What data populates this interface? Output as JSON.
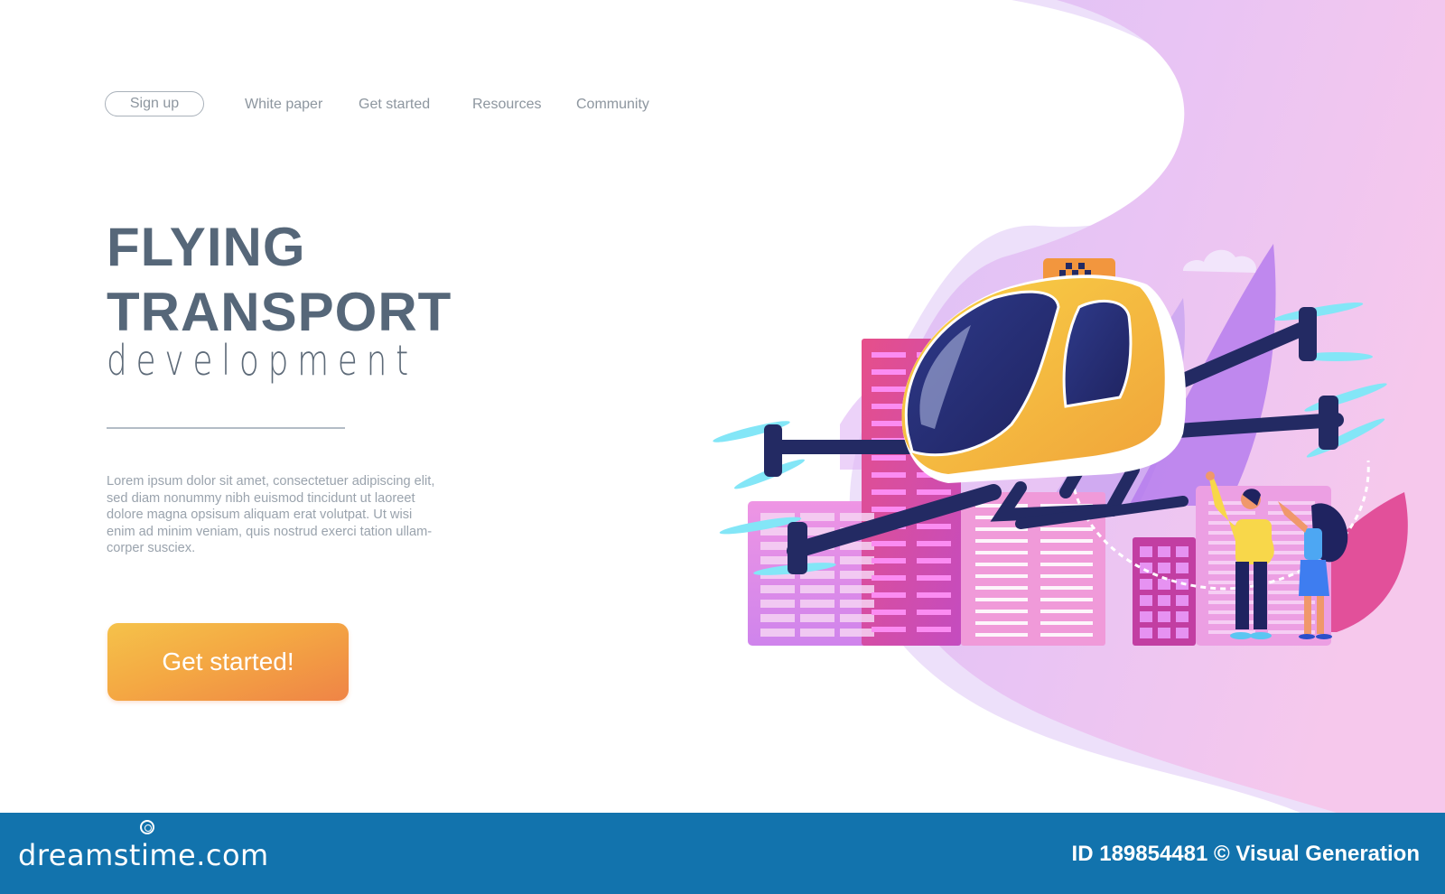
{
  "nav": {
    "signup_label": "Sign up",
    "links": [
      "White paper",
      "Get started",
      "Resources",
      "Community"
    ]
  },
  "hero": {
    "title_line1": "FLYING",
    "title_line2": "TRANSPORT",
    "subtitle": "development",
    "body_lines": [
      "Lorem ipsum dolor sit amet, consectetuer adipiscing elit,",
      "sed diam nonummy nibh euismod tincidunt ut laoreet",
      "dolore magna opsisum aliquam erat volutpat. Ut wisi",
      "enim ad minim veniam, quis nostrud exerci tation ullam-",
      "corper susciex."
    ],
    "cta_label": "Get started!"
  },
  "illustration": {
    "subject": "flying-taxi-drone-over-city",
    "colors": {
      "blob_light": "#e7c9f7",
      "blob_pink": "#f5c6ee",
      "taxi_yellow": "#f7c43a",
      "taxi_orange": "#f2963e",
      "navy": "#232a63",
      "propeller": "#7fe3f5",
      "building_pink": "#e977d9",
      "building_magenta": "#d6408e",
      "building_violet": "#b46be6"
    }
  },
  "footer": {
    "logo_text": "dreamstime.com",
    "credit": "ID 189854481 © Visual Generation"
  },
  "colors": {
    "heading": "#566779",
    "nav_text": "#8d969f",
    "body_text": "#9aa3ad",
    "cta_start": "#f5c24a",
    "cta_end": "#ef8446",
    "footer_bg": "#1273ad"
  }
}
